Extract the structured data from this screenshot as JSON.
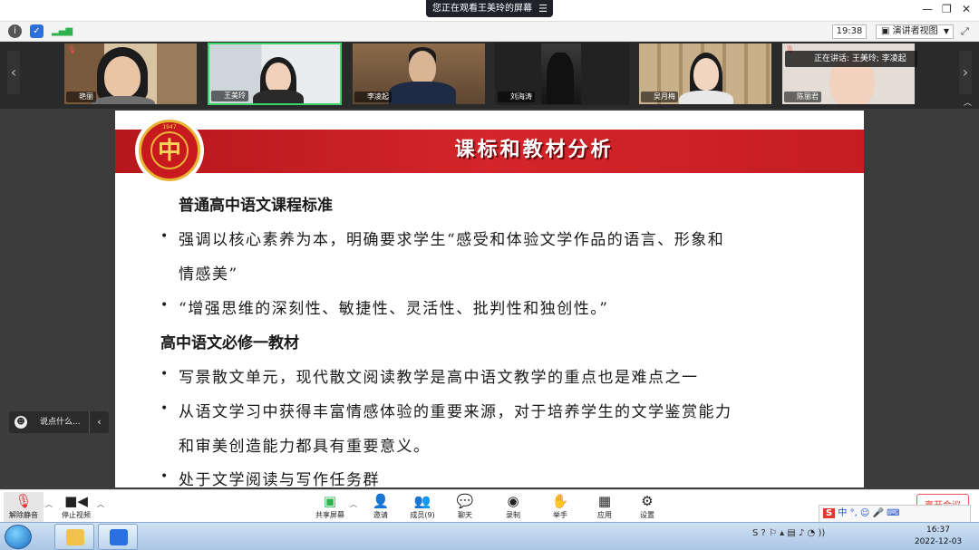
{
  "top_bar": {
    "share_banner": "您正在观看王美玲的屏幕",
    "menu_icon": "menu-icon",
    "window_controls": [
      "minimize-icon",
      "restore-icon",
      "close-icon"
    ]
  },
  "toolbar": {
    "clock": "19:38",
    "view_label": "演讲者视图",
    "icons": [
      "info-icon",
      "shield-icon",
      "signal-icon",
      "fullscreen-icon"
    ]
  },
  "participants": [
    {
      "name": "艳丽",
      "muted": true
    },
    {
      "name": "王美玲",
      "muted": false,
      "active": true
    },
    {
      "name": "李凌起",
      "muted": false
    },
    {
      "name": "刘海涛",
      "muted": false
    },
    {
      "name": "吴月梅",
      "muted": false
    },
    {
      "name": "陈丽君",
      "muted": true
    }
  ],
  "speaking_now": "正在讲话: 王美玲; 李凌起",
  "slide": {
    "title": "课标和教材分析",
    "logo_text": "中",
    "logo_ring": "1947",
    "heading1": "普通高中语文课程标准",
    "bullet1_line1": "强调以核心素养为本，明确要求学生“感受和体验文学作品的语言、形象和",
    "bullet1_line2": "情感美”",
    "bullet2": "“增强思维的深刻性、敏捷性、灵活性、批判性和独创性。”",
    "heading2": "高中语文必修一教材",
    "bullet3": "写景散文单元，现代散文阅读教学是高中语文教学的重点也是难点之一",
    "bullet4_line1": "从语文学习中获得丰富情感体验的重要来源，对于培养学生的文学鉴赏能力",
    "bullet4_line2": "和审美创造能力都具有重要意义。",
    "bullet5": "处于文学阅读与写作任务群",
    "bullet_char": "•"
  },
  "chat": {
    "placeholder": "说点什么..."
  },
  "bottom_toolbar": {
    "unmute": "解除静音",
    "stop_video": "停止视频",
    "share_screen": "共享屏幕",
    "invite": "邀请",
    "members": "成员(9)",
    "chat": "聊天",
    "record": "录制",
    "raise_hand": "举手",
    "apps": "应用",
    "settings": "设置",
    "leave": "离开会议"
  },
  "ime": "中 °, ☺ 🎤 ⌨",
  "taskbar": {
    "time": "16:37",
    "date": "2022-12-03"
  }
}
